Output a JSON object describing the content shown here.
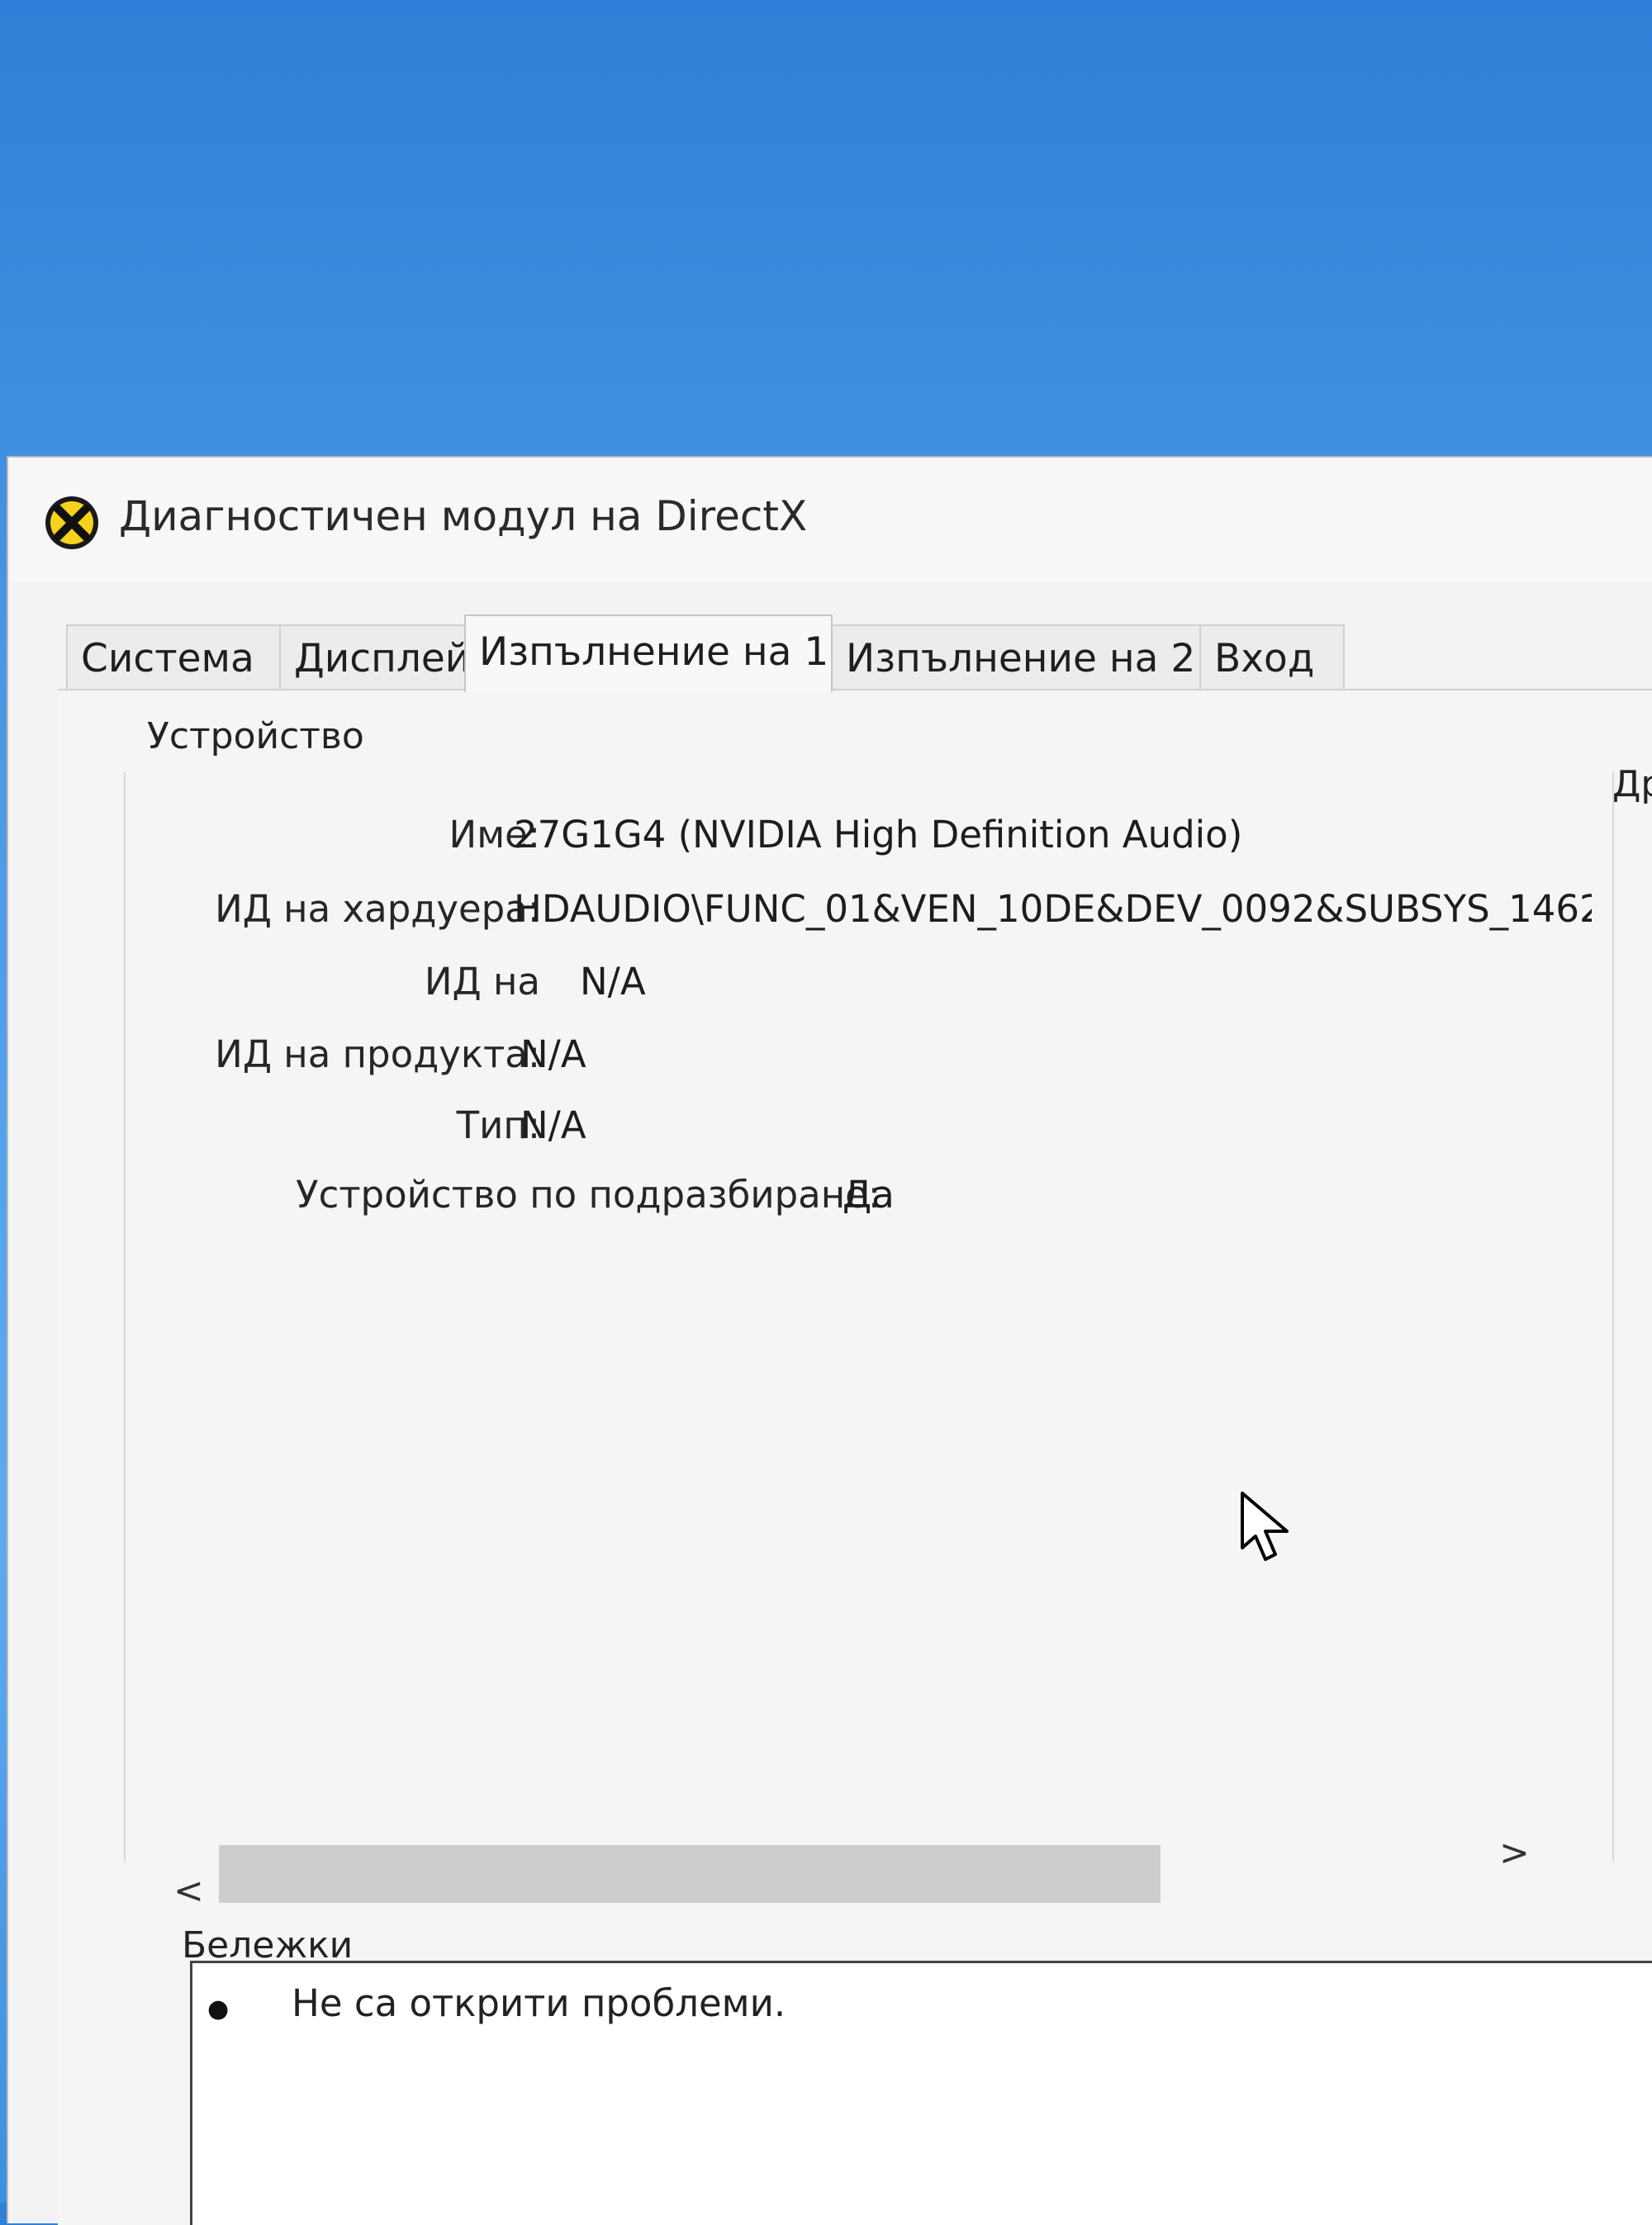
{
  "window": {
    "title": "Диагностичен модул на DirectX",
    "icon": "directx-icon"
  },
  "tabs": [
    {
      "label": "Система",
      "active": false
    },
    {
      "label": "Дисплей",
      "active": false
    },
    {
      "label": "Изпълнение на 1",
      "active": true
    },
    {
      "label": "Изпълнение на 2",
      "active": false
    },
    {
      "label": "Вход",
      "active": false
    }
  ],
  "device": {
    "group_label": "Устройство",
    "right_group_label_partial": "Др",
    "fields": [
      {
        "label": "Име:",
        "value": "27G1G4 (NVIDIA High Definition Audio)"
      },
      {
        "label": "ИД на хардуера:",
        "value": "HDAUDIO\\FUNC_01&VEN_10DE&DEV_0092&SUBSYS_1462"
      },
      {
        "label": "ИД на",
        "value": "N/A"
      },
      {
        "label": "ИД на продукта:",
        "value": "N/A"
      },
      {
        "label": "Тип:",
        "value": "N/A"
      },
      {
        "label": "Устройство по подразбиране:",
        "value": "Да"
      }
    ]
  },
  "scrollbar": {
    "left_arrow": "<",
    "right_arrow": ">"
  },
  "notes": {
    "label": "Бележки",
    "items": [
      "Не са открити проблеми."
    ]
  },
  "icons": {
    "title": "directx-icon",
    "cursor": "mouse-pointer-icon",
    "bullet": "bullet-icon"
  },
  "colors": {
    "desktop_blue": "#3b90df",
    "window_bg": "#f3f3f3",
    "scroll_track": "#cdcdcd",
    "notes_bg": "#ffffff"
  }
}
